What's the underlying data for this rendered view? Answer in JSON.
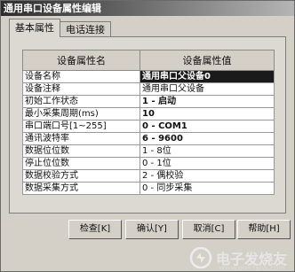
{
  "window": {
    "title": "通用串口设备属性编辑"
  },
  "tabs": [
    {
      "label": "基本属性",
      "active": true
    },
    {
      "label": "电话连接",
      "active": false
    }
  ],
  "table": {
    "headers": [
      "设备属性名",
      "设备属性值"
    ],
    "rows": [
      {
        "name": "设备名称",
        "value": "通用串口父设备0",
        "selected": true
      },
      {
        "name": "设备注释",
        "value": "通用串口父设备"
      },
      {
        "name": "初始工作状态",
        "value": "1 - 启动"
      },
      {
        "name": "最小采集周期(ms)",
        "value": "10"
      },
      {
        "name": "串口端口号[1~255]",
        "value": "0 - COM1"
      },
      {
        "name": "通讯波特率",
        "value": "6 - 9600"
      },
      {
        "name": "数据位位数",
        "value": "1 - 8位"
      },
      {
        "name": "停止位位数",
        "value": "0 - 1位"
      },
      {
        "name": "数据校验方式",
        "value": "2 - 偶校验"
      },
      {
        "name": "数据采集方式",
        "value": "0 - 同步采集"
      }
    ]
  },
  "buttons": {
    "check": "检查[K]",
    "confirm": "确认[Y]",
    "cancel": "取消[C]",
    "help": "帮助[H]"
  },
  "watermark": {
    "text": "电子发烧友",
    "sub": "www.elecfans.com"
  }
}
